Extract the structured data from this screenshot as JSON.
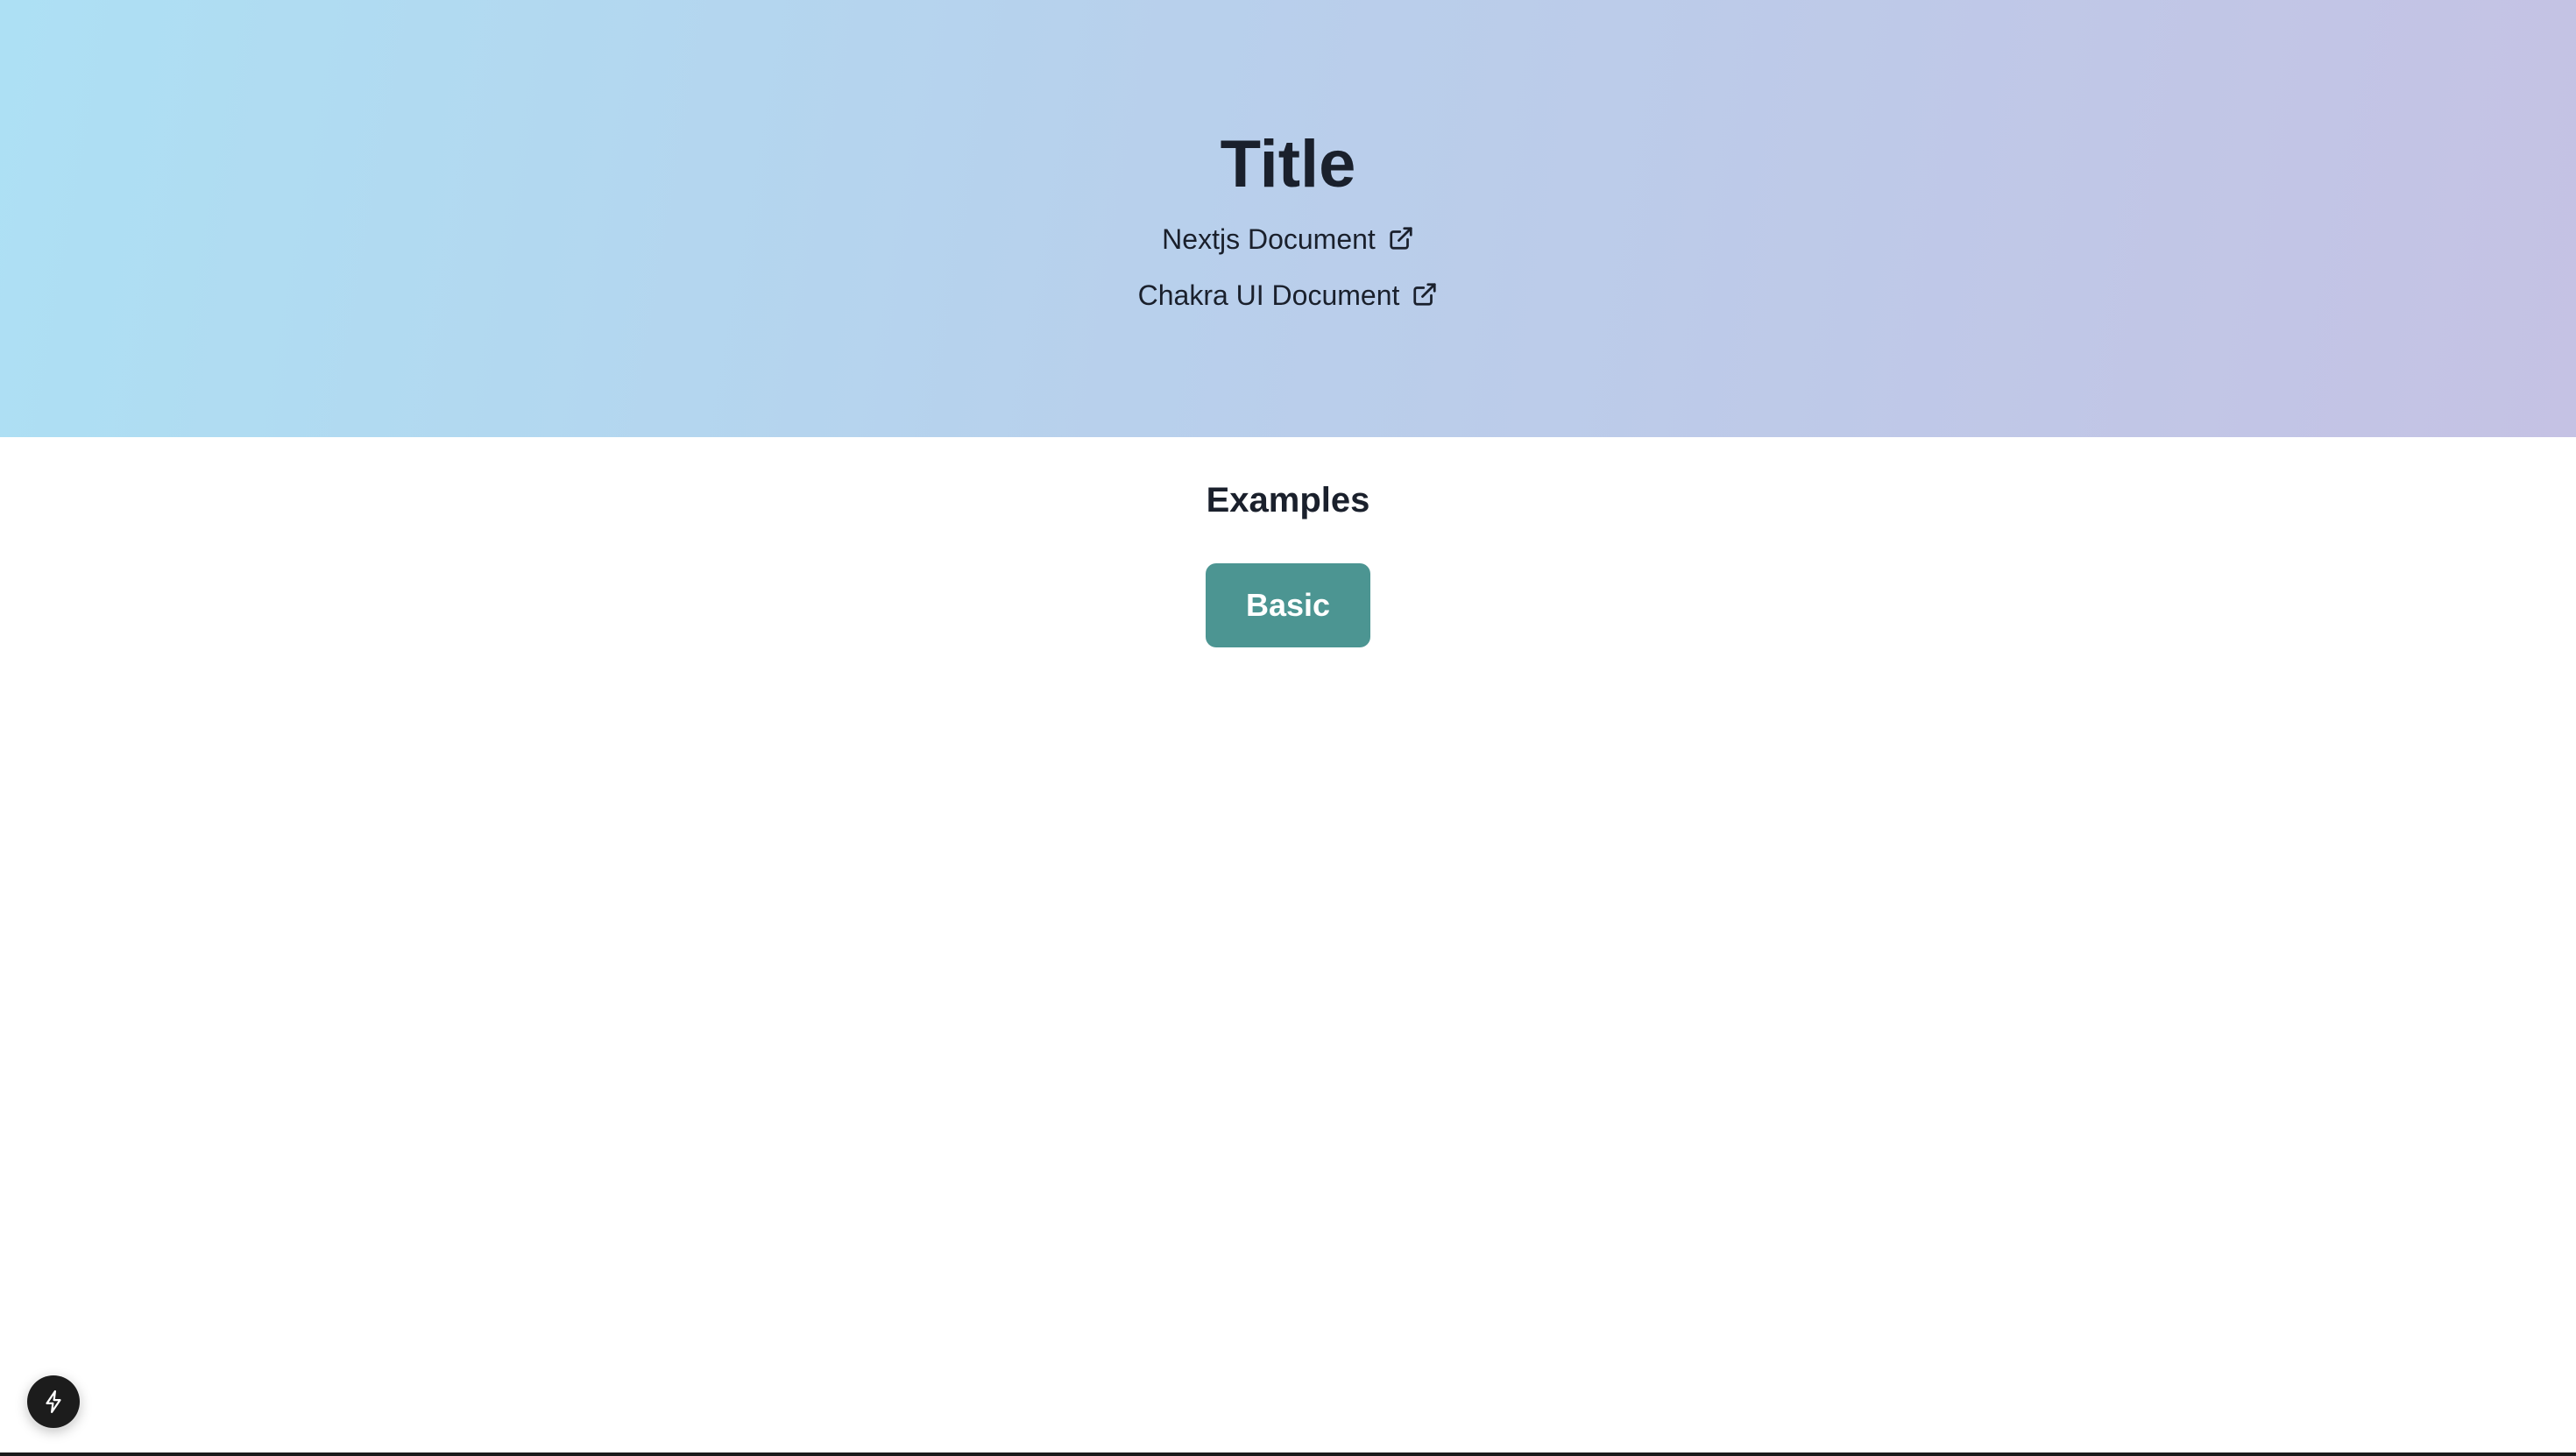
{
  "hero": {
    "title": "Title",
    "links": [
      {
        "label": "Nextjs Document",
        "icon": "external-link-icon"
      },
      {
        "label": "Chakra UI Document",
        "icon": "external-link-icon"
      }
    ],
    "gradient": [
      "#ade0f4",
      "#b8d0ec",
      "#c5c2e4"
    ]
  },
  "examples": {
    "heading": "Examples",
    "buttons": [
      {
        "label": "Basic",
        "color": "#4c9592"
      }
    ]
  },
  "dev_indicator": {
    "icon": "lightning-bolt-icon"
  },
  "colors": {
    "text": "#1a202c",
    "button": "#4c9592",
    "indicator": "#1c1c1c"
  }
}
